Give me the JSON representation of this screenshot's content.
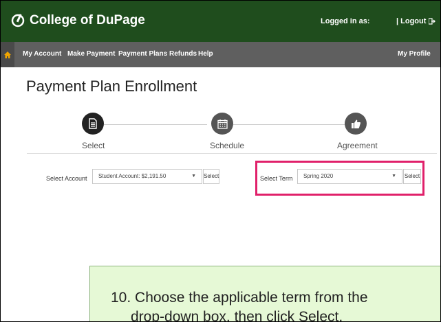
{
  "header": {
    "brand": "College of DuPage",
    "logged_in": "Logged in as:",
    "logout": "| Logout"
  },
  "nav": {
    "items": [
      "My Account",
      "Make Payment",
      "Payment Plans",
      "Refunds",
      "Help"
    ],
    "profile": "My Profile"
  },
  "page": {
    "title": "Payment Plan Enrollment",
    "steps": [
      {
        "label": "Select",
        "icon": "document-icon"
      },
      {
        "label": "Schedule",
        "icon": "calendar-icon"
      },
      {
        "label": "Agreement",
        "icon": "thumbs-up-icon"
      }
    ]
  },
  "form": {
    "account_label": "Select Account",
    "account_value": "Student Account: $2,191.50",
    "account_button": "Select",
    "term_label": "Select Term",
    "term_value": "Spring 2020",
    "term_button": "Select"
  },
  "callout": {
    "line1": "10. Choose the applicable term from the",
    "line2": "drop-down box, then click Select."
  },
  "colors": {
    "header_bg": "#1f4d1d",
    "nav_bg": "#5f5f5f",
    "highlight": "#e0206a",
    "callout_bg": "#e6f9d6",
    "home_icon": "#f0a500"
  }
}
